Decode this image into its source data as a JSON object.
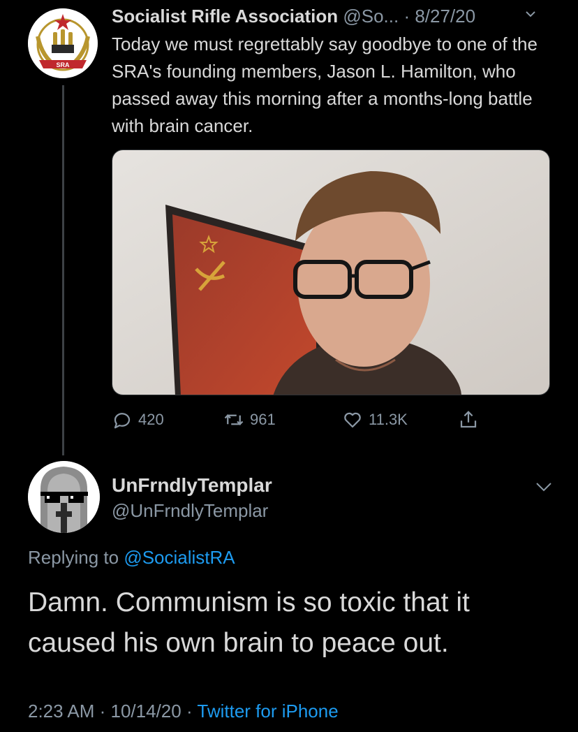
{
  "tweet": {
    "author_name": "Socialist Rifle Association",
    "author_handle": "@So...",
    "separator": " · ",
    "date": "8/27/20",
    "avatar_badge": "SRA",
    "text": "Today we must regrettably say goodbye to one of the SRA's founding members, Jason L. Hamilton, who passed away this morning after a months-long battle with brain cancer.",
    "stats": {
      "replies": "420",
      "retweets": "961",
      "likes": "11.3K"
    }
  },
  "reply": {
    "author_name": "UnFrndlyTemplar",
    "author_handle": "@UnFrndlyTemplar",
    "replying_prefix": "Replying to ",
    "replying_to": "@SocialistRA",
    "text": "Damn. Communism is so toxic that it caused his own brain to peace out.",
    "time": "2:23 AM",
    "sep": " · ",
    "date": "10/14/20",
    "sep2": " · ",
    "source": "Twitter for iPhone"
  },
  "icons": {
    "reply": "speech-bubble-icon",
    "retweet": "retweet-icon",
    "like": "heart-icon",
    "share": "share-icon",
    "menu": "chevron-down-icon"
  },
  "colors": {
    "background": "#000000",
    "text": "#d9d9d9",
    "secondary": "#8b98a5",
    "link": "#1d9bf0"
  }
}
